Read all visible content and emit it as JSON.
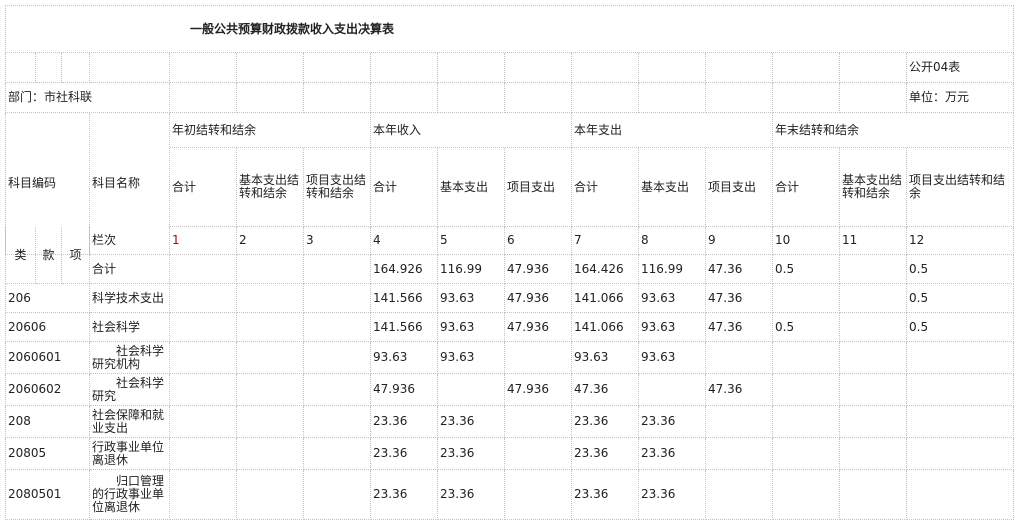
{
  "report": {
    "title": "一般公共预算财政拨款收入支出决算表",
    "table_no": "公开04表",
    "department": "部门：市社科联",
    "unit": "单位：万元"
  },
  "headers": {
    "code": "科目编码",
    "name": "科目名称",
    "group_begin": "年初结转和结余",
    "group_income": "本年收入",
    "group_expense": "本年支出",
    "group_end": "年末结转和结余",
    "total": "合计",
    "basic_carry": "基本支出结转和结余",
    "project_carry": "项目支出结转和结余",
    "basic_exp": "基本支出",
    "project_exp": "项目支出",
    "end_project_carry": "项目支出结转和结余",
    "lei": "类",
    "kuan": "款",
    "xiang": "项",
    "lanci": "栏次",
    "col_numbers": [
      "1",
      "2",
      "3",
      "4",
      "5",
      "6",
      "7",
      "8",
      "9",
      "10",
      "11",
      "12"
    ]
  },
  "rows": [
    {
      "code": "",
      "name": "合计",
      "v": [
        "",
        "",
        "",
        "164.926",
        "116.99",
        "47.936",
        "164.426",
        "116.99",
        "47.36",
        "0.5",
        "",
        "0.5"
      ]
    },
    {
      "code": "206",
      "name": "科学技术支出",
      "v": [
        "",
        "",
        "",
        "141.566",
        "93.63",
        "47.936",
        "141.066",
        "93.63",
        "47.36",
        "",
        "",
        "0.5"
      ]
    },
    {
      "code": "20606",
      "name": "社会科学",
      "v": [
        "",
        "",
        "",
        "141.566",
        "93.63",
        "47.936",
        "141.066",
        "93.63",
        "47.36",
        "0.5",
        "",
        "0.5"
      ]
    },
    {
      "code": "2060601",
      "name": "　　社会科学研究机构",
      "v": [
        "",
        "",
        "",
        "93.63",
        "93.63",
        "",
        "93.63",
        "93.63",
        "",
        "",
        "",
        ""
      ]
    },
    {
      "code": "2060602",
      "name": "　　社会科学研究",
      "v": [
        "",
        "",
        "",
        "47.936",
        "",
        "47.936",
        "47.36",
        "",
        "47.36",
        "",
        "",
        ""
      ]
    },
    {
      "code": "208",
      "name": "社会保障和就业支出",
      "v": [
        "",
        "",
        "",
        "23.36",
        "23.36",
        "",
        "23.36",
        "23.36",
        "",
        "",
        "",
        ""
      ]
    },
    {
      "code": "20805",
      "name": "行政事业单位离退休",
      "v": [
        "",
        "",
        "",
        "23.36",
        "23.36",
        "",
        "23.36",
        "23.36",
        "",
        "",
        "",
        ""
      ]
    },
    {
      "code": "2080501",
      "name": "　　归口管理的行政事业单位离退休",
      "v": [
        "",
        "",
        "",
        "23.36",
        "23.36",
        "",
        "23.36",
        "23.36",
        "",
        "",
        "",
        ""
      ]
    }
  ]
}
